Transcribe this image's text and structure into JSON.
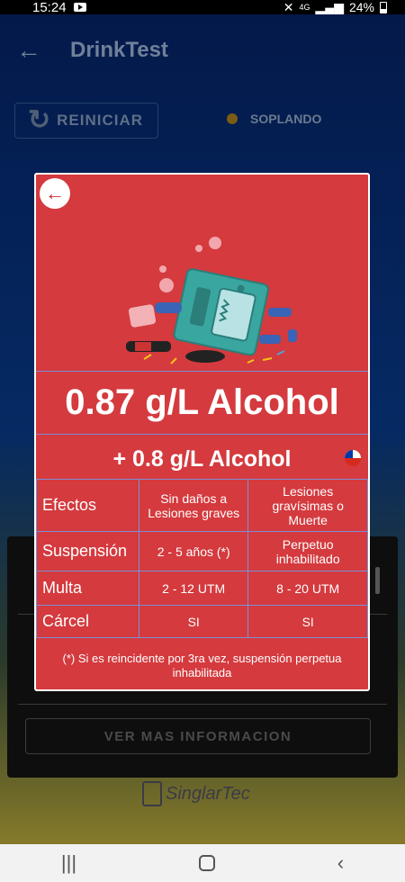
{
  "status_bar": {
    "time": "15:24",
    "battery": "24%",
    "network": "4G"
  },
  "app": {
    "title": "DrinkTest",
    "reset_label": "REINICIAR",
    "blow_status": "SOPLANDO",
    "more_info_label": "VER MAS INFORMACION",
    "logo_text": "SinglarTec"
  },
  "modal": {
    "amount": "0.87 g/L Alcohol",
    "threshold": "+ 0.8 g/L Alcohol",
    "rows": [
      {
        "label": "Efectos",
        "col1": "Sin daños a Lesiones graves",
        "col2": "Lesiones gravísimas o Muerte"
      },
      {
        "label": "Suspensión",
        "col1": "2 - 5 años (*)",
        "col2": "Perpetuo inhabilitado"
      },
      {
        "label": "Multa",
        "col1": "2 - 12 UTM",
        "col2": "8 - 20 UTM"
      },
      {
        "label": "Cárcel",
        "col1": "SI",
        "col2": "SI"
      }
    ],
    "footnote": "(*) Si es reincidente por 3ra vez, suspensión perpetua inhabilitada"
  },
  "colors": {
    "modal_bg": "#d43a3e",
    "grid_lines": "#7b8fd6",
    "robot": "#3aa6a0"
  }
}
